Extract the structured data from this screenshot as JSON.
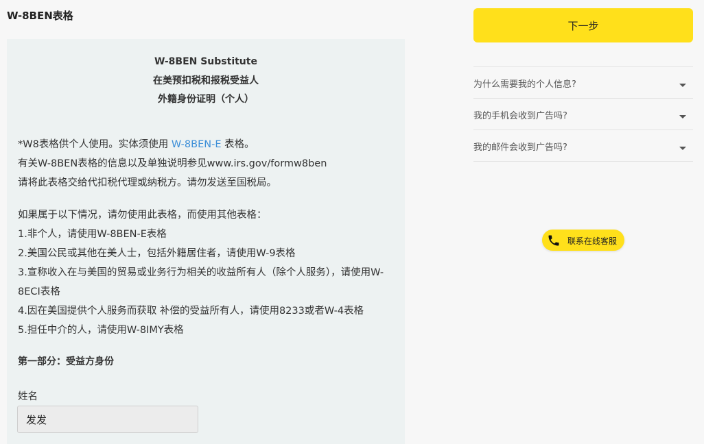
{
  "form_title": "W-8BEN表格",
  "panel": {
    "heading": [
      "W-8BEN Substitute",
      "在美预扣税和报税受益人",
      "外籍身份证明（个人）"
    ],
    "intro": {
      "line1_prefix": "*W8表格供个人使用。实体须使用 ",
      "line1_link": "W-8BEN-E",
      "line1_suffix": " 表格。",
      "line2": "有关W-8BEN表格的信息以及单独说明参见www.irs.gov/formw8ben",
      "line3": "请将此表格交给代扣税代理或纳税方。请勿发送至国税局。"
    },
    "warnings": [
      "如果属于以下情况，请勿使用此表格，而使用其他表格：",
      "1.非个人，请使用W-8BEN-E表格",
      "2.美国公民或其他在美人士，包括外籍居住者，请使用W-9表格",
      "3.宣称收入在与美国的贸易或业务行为相关的收益所有人（除个人服务），请使用W-8ECI表格",
      "4.因在美国提供个人服务而获取 补偿的受益所有人，请使用8233或者W-4表格",
      "5.担任中介的人，请使用W-8IMY表格"
    ],
    "section_title": "第一部分：受益方身份",
    "name_label": "姓名",
    "name_value": "发发"
  },
  "sidebar": {
    "next_label": "下一步",
    "faq": [
      "为什么需要我的个人信息?",
      "我的手机会收到广告吗?",
      "我的邮件会收到广告吗?"
    ],
    "support_label": "联系在线客服"
  },
  "colors": {
    "accent_yellow": "#ffe01b",
    "link_blue": "#3d8fd8",
    "panel_bg": "#edf2f2"
  },
  "icons": {
    "faq_toggle": "caret-down-icon",
    "support": "phone-icon"
  }
}
